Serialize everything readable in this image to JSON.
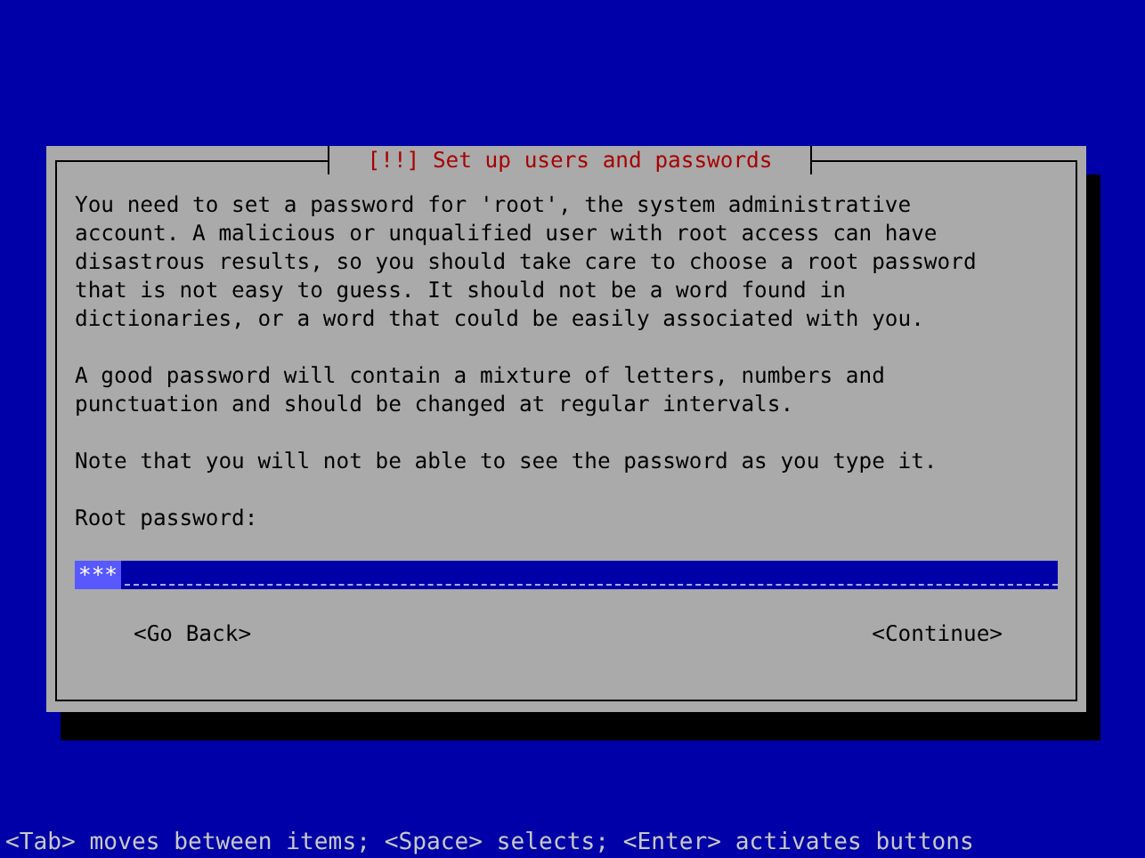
{
  "dialog": {
    "title": "[!!] Set up users and passwords",
    "paragraphs": [
      "You need to set a password for 'root', the system administrative account. A malicious or unqualified user with root access can have disastrous results, so you should take care to choose a root password that is not easy to guess. It should not be a word found in dictionaries, or a word that could be easily associated with you.",
      "A good password will contain a mixture of letters, numbers and punctuation and should be changed at regular intervals.",
      "Note that you will not be able to see the password as you type it."
    ],
    "field": {
      "label": "Root password:",
      "value": "***"
    },
    "buttons": [
      "<Go Back>",
      "<Continue>"
    ]
  },
  "status_bar": "<Tab> moves between items; <Space> selects; <Enter> activates buttons"
}
